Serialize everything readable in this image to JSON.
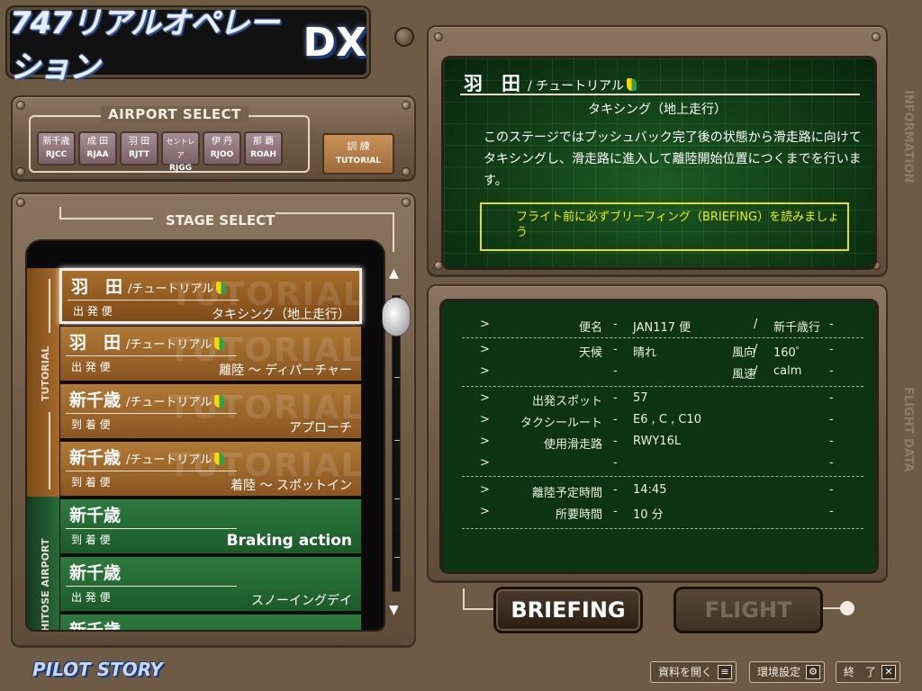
{
  "logo": {
    "text": "747リアルオペレーション",
    "dx": "DX"
  },
  "airport_select": {
    "label": "AIRPORT SELECT",
    "airports": [
      {
        "name": "新千歳",
        "code": "RJCC"
      },
      {
        "name": "成 田",
        "code": "RJAA"
      },
      {
        "name": "羽 田",
        "code": "RJTT"
      },
      {
        "name": "セントレア",
        "code": "RJGG"
      },
      {
        "name": "伊 丹",
        "code": "RJOO"
      },
      {
        "name": "那 覇",
        "code": "ROAH"
      }
    ],
    "tutorial_button": {
      "name": "訓 練",
      "code": "TUTORIAL"
    }
  },
  "stage_select": {
    "label": "STAGE SELECT",
    "band_tutorial": "TUTORIAL",
    "band_chitose": "CHITOSE AIRPORT",
    "stages": [
      {
        "airport": "羽　田",
        "tag": "/チュートリアル",
        "flight": "出 発 便",
        "mission": "タキシング（地上走行）",
        "group": "tut",
        "selected": true
      },
      {
        "airport": "羽　田",
        "tag": "/チュートリアル",
        "flight": "出 発 便",
        "mission": "離陸 ～ ディパーチャー",
        "group": "tut",
        "selected": false
      },
      {
        "airport": "新千歳",
        "tag": "/チュートリアル",
        "flight": "到 着 便",
        "mission": "アプローチ",
        "group": "tut",
        "selected": false
      },
      {
        "airport": "新千歳",
        "tag": "/チュートリアル",
        "flight": "到 着 便",
        "mission": "着陸 ～ スポットイン",
        "group": "tut",
        "selected": false
      },
      {
        "airport": "新千歳",
        "tag": "",
        "flight": "到 着 便",
        "mission": "Braking action",
        "group": "chi",
        "selected": false
      },
      {
        "airport": "新千歳",
        "tag": "",
        "flight": "出 発 便",
        "mission": "スノーイングデイ",
        "group": "chi",
        "selected": false
      },
      {
        "airport": "新千歳",
        "tag": "",
        "flight": "",
        "mission": "",
        "group": "chi",
        "selected": false
      }
    ],
    "scroll_up": "▲",
    "scroll_down": "▼"
  },
  "information": {
    "side_label": "INFORMATION",
    "title_airport": "羽　田",
    "title_tag": "/ チュートリアル",
    "subtitle": "タキシング（地上走行）",
    "body": "このステージではプッシュバック完了後の状態から滑走路に向けてタキシングし、滑走路に進入して離陸開始位置につくまでを行います。",
    "note": "フライト前に必ずブリーフィング（BRIEFING）を読みましょう"
  },
  "flight_data": {
    "side_label": "FLIGHT DATA",
    "rows": [
      {
        "k": "便名",
        "v": "JAN117 便",
        "s": "/",
        "v2": "新千歳行",
        "k2": ""
      },
      {
        "k": "天候",
        "v": "晴れ",
        "k2": "風向",
        "s": "/",
        "v2": "160゜"
      },
      {
        "k": "",
        "v": "",
        "k2": "風速",
        "s": "/",
        "v2": "calm"
      },
      {
        "k": "出発スポット",
        "v": "57",
        "k2": "",
        "s": "",
        "v2": ""
      },
      {
        "k": "タクシールート",
        "v": "E6 , C , C10",
        "k2": "",
        "s": "",
        "v2": ""
      },
      {
        "k": "使用滑走路",
        "v": "RWY16L",
        "k2": "",
        "s": "",
        "v2": ""
      },
      {
        "k": "",
        "v": "",
        "k2": "",
        "s": "",
        "v2": ""
      },
      {
        "k": "離陸予定時間",
        "v": "14:45",
        "k2": "",
        "s": "",
        "v2": ""
      },
      {
        "k": "所要時間",
        "v": "10 分",
        "k2": "",
        "s": "",
        "v2": ""
      }
    ]
  },
  "buttons": {
    "briefing": "BRIEFING",
    "flight": "FLIGHT"
  },
  "footer": {
    "brand": "PILOT STORY",
    "open_docs": "資料を開く",
    "settings": "環境設定",
    "quit": "終　了"
  },
  "colors": {
    "panel": "#6f5c48",
    "screen": "#0d3412",
    "tutorial": "#9c6a38",
    "chitose": "#1c5a2a",
    "note": "#f2f000"
  }
}
